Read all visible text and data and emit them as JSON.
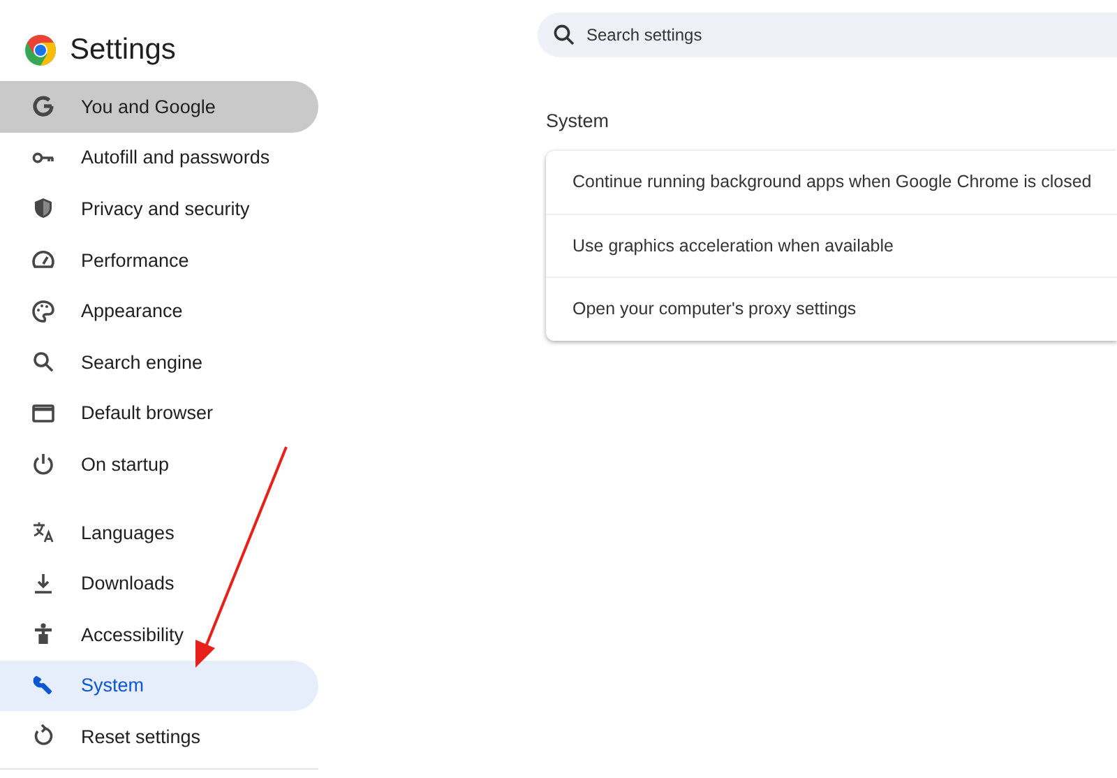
{
  "header": {
    "title": "Settings"
  },
  "sidebar": {
    "groups": [
      {
        "items": [
          {
            "label": "You and Google",
            "selected": false,
            "hovered": true
          },
          {
            "label": "Autofill and passwords",
            "selected": false,
            "hovered": false
          },
          {
            "label": "Privacy and security",
            "selected": false,
            "hovered": false
          },
          {
            "label": "Performance",
            "selected": false,
            "hovered": false
          },
          {
            "label": "Appearance",
            "selected": false,
            "hovered": false
          },
          {
            "label": "Search engine",
            "selected": false,
            "hovered": false
          },
          {
            "label": "Default browser",
            "selected": false,
            "hovered": false
          },
          {
            "label": "On startup",
            "selected": false,
            "hovered": false
          }
        ]
      },
      {
        "items": [
          {
            "label": "Languages",
            "selected": false,
            "hovered": false
          },
          {
            "label": "Downloads",
            "selected": false,
            "hovered": false
          },
          {
            "label": "Accessibility",
            "selected": false,
            "hovered": false
          },
          {
            "label": "System",
            "selected": true,
            "hovered": false
          },
          {
            "label": "Reset settings",
            "selected": false,
            "hovered": false
          }
        ]
      }
    ]
  },
  "search": {
    "placeholder": "Search settings"
  },
  "section": {
    "title": "System",
    "rows": [
      {
        "label": "Continue running background apps when Google Chrome is closed"
      },
      {
        "label": "Use graphics acceleration when available"
      },
      {
        "label": "Open your computer's proxy settings"
      }
    ]
  }
}
